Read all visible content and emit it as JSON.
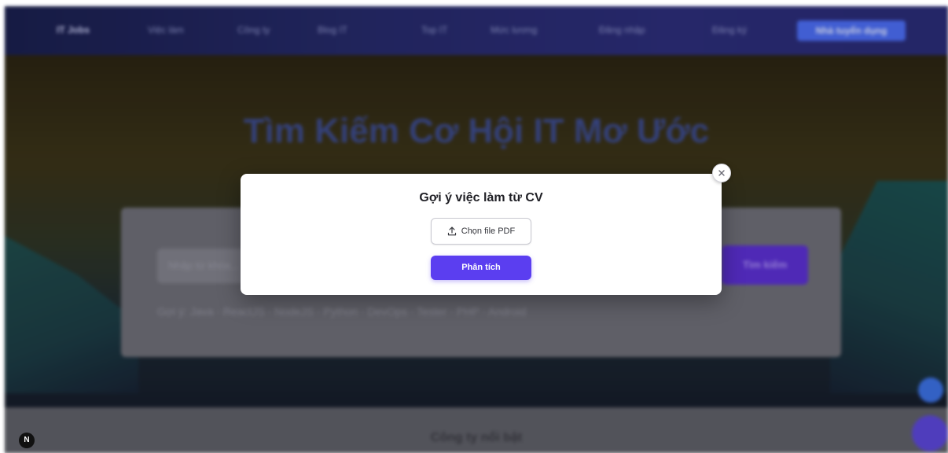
{
  "navbar": {
    "items": [
      "IT Jobs",
      "Việc làm",
      "Công ty",
      "Blog IT",
      "Top IT",
      "Mức lương"
    ],
    "login_label": "Đăng nhập",
    "register_label": "Đăng ký",
    "cta_label": "Nhà tuyển dụng"
  },
  "hero": {
    "title": "Tìm Kiếm Cơ Hội IT Mơ Ước",
    "search_placeholder": "Nhập từ khóa...",
    "search_button": "Tìm kiếm",
    "tags_line": "Gợi ý: Java · ReactJS · NodeJS · Python · DevOps · Tester · PHP · Android"
  },
  "bottom": {
    "section_title": "Công ty nổi bật"
  },
  "badge": {
    "label": "N"
  },
  "modal": {
    "title": "Gợi ý việc làm từ CV",
    "choose_file_label": "Chọn file PDF",
    "analyze_label": "Phân tích"
  },
  "colors": {
    "primary": "#5b3ef0",
    "nav_bg": "#262a6a",
    "cta": "#4a6bf0"
  },
  "icons": {
    "upload": "upload-icon",
    "close": "close-icon"
  }
}
